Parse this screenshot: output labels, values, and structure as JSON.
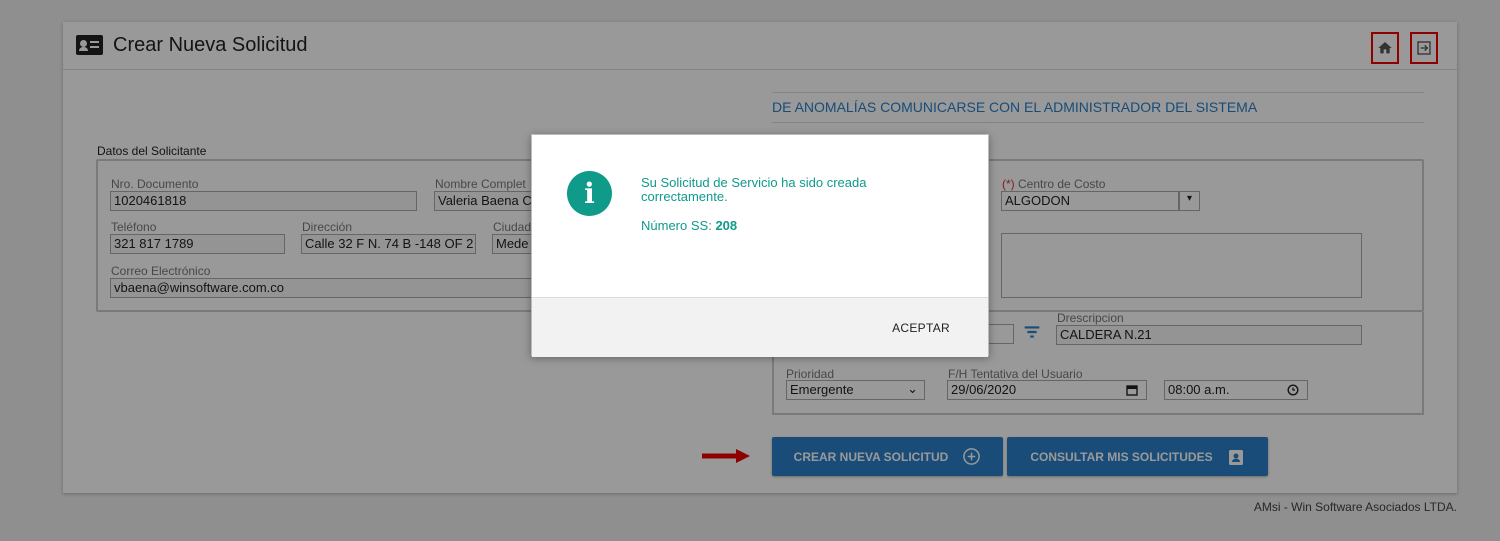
{
  "header": {
    "title": "Crear Nueva Solicitud",
    "icons": {
      "title": "contact-card-icon",
      "home": "home-icon",
      "exit": "exit-icon"
    }
  },
  "notice": "DE ANOMALÍAS COMUNICARSE CON EL ADMINISTRADOR DEL SISTEMA",
  "solicitante": {
    "section_label": "Datos del Solicitante",
    "nro_documento": {
      "label": "Nro. Documento",
      "value": "1020461818"
    },
    "nombre_completo": {
      "label": "Nombre Complet",
      "value": "Valeria Baena C"
    },
    "telefono": {
      "label": "Teléfono",
      "value": "321 817 1789"
    },
    "direccion": {
      "label": "Dirección",
      "value": "Calle 32 F N. 74 B -148 OF 2"
    },
    "ciudad": {
      "label": "Ciudad",
      "value": "Mede"
    },
    "correo": {
      "label": "Correo Electrónico",
      "value": "vbaena@winsoftware.com.co"
    }
  },
  "servicio": {
    "centro_costo": {
      "required_mark": "(*)",
      "label": "Centro de Costo",
      "value": "ALGODON"
    },
    "descripcion": {
      "label": "Drescripcion",
      "value": "CALDERA N.21"
    },
    "prioridad": {
      "label": "Prioridad",
      "value": "Emergente"
    },
    "fecha": {
      "label": "F/H Tentativa del Usuario",
      "date": "29/06/2020",
      "time": "08:00 a.m."
    }
  },
  "buttons": {
    "crear": "CREAR NUEVA SOLICITUD",
    "consultar": "CONSULTAR MIS SOLICITUDES"
  },
  "footer": "AMsi - Win Software Asociados LTDA.",
  "modal": {
    "message": "Su Solicitud de Servicio ha sido creada correctamente.",
    "ss_label": "Número SS:",
    "ss_number": "208",
    "accept": "ACEPTAR"
  },
  "colors": {
    "primary": "#2a7fc9",
    "teal": "#0f9a8a",
    "highlight": "#e00000"
  }
}
